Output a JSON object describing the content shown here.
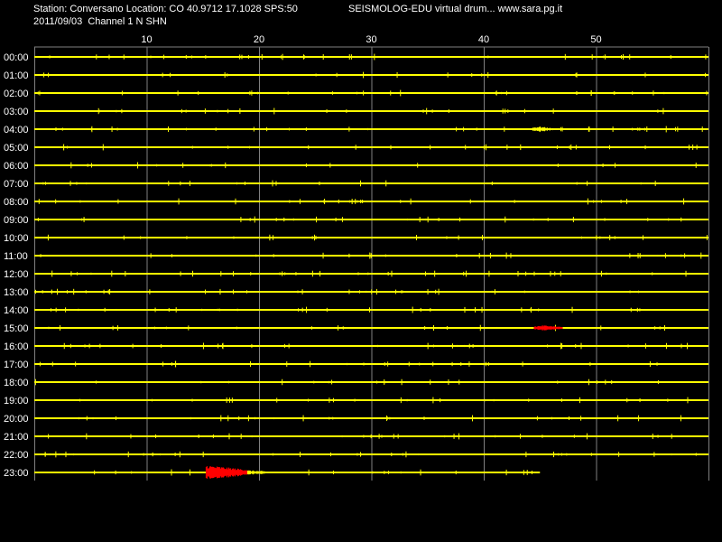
{
  "header": {
    "station_line": "Station: Conversano Location: CO 40.9712 17.1028 SPS:50",
    "date_line": "2011/09/03  Channel 1 N SHN",
    "app_line": "SEISMOLOG-EDU virtual drum... www.sara.pg.it"
  },
  "colors": {
    "background": "#000000",
    "trace": "#ffff00",
    "event": "#ff0000",
    "grid": "#808080",
    "text": "#ffffff"
  },
  "drum": {
    "minute_ticks": [
      "10",
      "20",
      "30",
      "40",
      "50"
    ],
    "hours": [
      "00:00",
      "01:00",
      "02:00",
      "03:00",
      "04:00",
      "05:00",
      "06:00",
      "07:00",
      "08:00",
      "09:00",
      "10:00",
      "11:00",
      "12:00",
      "13:00",
      "14:00",
      "15:00",
      "16:00",
      "17:00",
      "18:00",
      "19:00",
      "20:00",
      "21:00",
      "22:00",
      "23:00"
    ],
    "recording_end_minute": 45.0,
    "events": [
      {
        "hour": 4,
        "start_min": 44.3,
        "end_min": 46.2,
        "color": "yellow"
      },
      {
        "hour": 15,
        "start_min": 44.5,
        "end_min": 47.0,
        "color": "red"
      },
      {
        "hour": 23,
        "start_min": 15.3,
        "end_min": 19.0,
        "color": "red"
      },
      {
        "hour": 23,
        "start_min": 19.0,
        "end_min": 22.5,
        "color": "yellow"
      }
    ]
  }
}
